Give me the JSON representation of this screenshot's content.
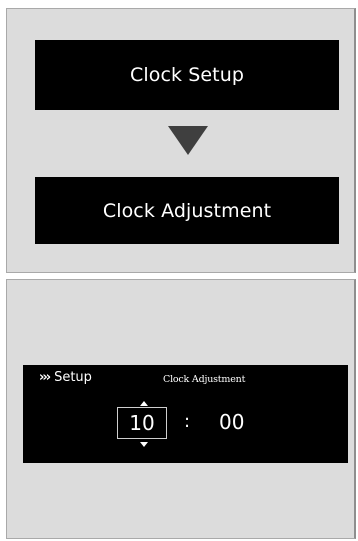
{
  "flow": {
    "step1_label": "Clock Setup",
    "step2_label": "Clock Adjustment"
  },
  "display": {
    "breadcrumb_chevrons": "›››",
    "breadcrumb_label": "Setup",
    "title": "Clock Adjustment",
    "hour": "10",
    "separator": ":",
    "minute": "00"
  },
  "colors": {
    "panel_background": "#dcdcdc",
    "screen_background": "#000000",
    "screen_text": "#ffffff",
    "arrow": "#3f3f3f"
  },
  "icons": {
    "flow_arrow": "arrow-down-icon",
    "breadcrumb": "chevrons-icon",
    "increment": "arrow-up-icon",
    "decrement": "arrow-down-icon"
  }
}
